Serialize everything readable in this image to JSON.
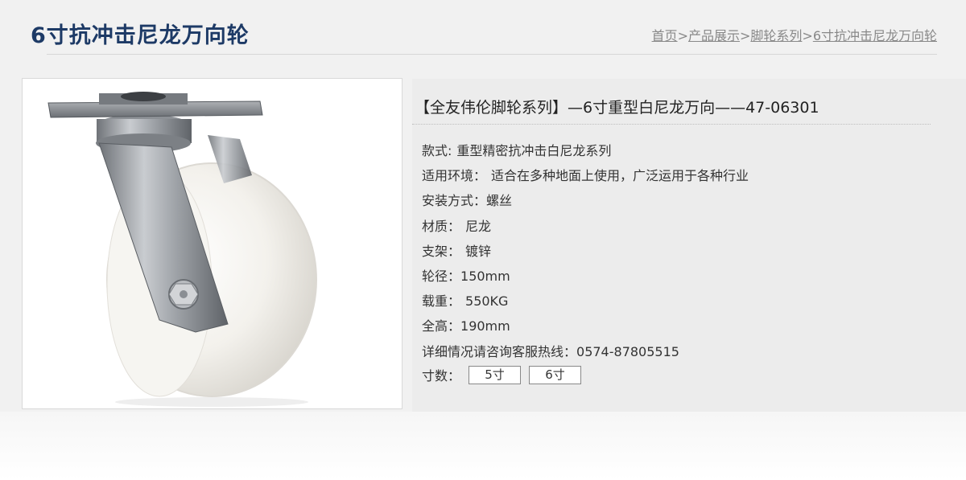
{
  "page_title": "6寸抗冲击尼龙万向轮",
  "breadcrumb": [
    {
      "label": "首页"
    },
    {
      "label": "产品展示"
    },
    {
      "label": "脚轮系列"
    },
    {
      "label": "6寸抗冲击尼龙万向轮"
    }
  ],
  "breadcrumb_separator": ">",
  "product": {
    "image_icon": "nylon-swivel-caster-wheel-photo",
    "heading": "【全友伟伦脚轮系列】—6寸重型白尼龙万向——47-06301",
    "specs": [
      {
        "label": "款式:",
        "value": "重型精密抗冲击白尼龙系列"
      },
      {
        "label": "适用环境：",
        "value": "适合在多种地面上使用，广泛运用于各种行业"
      },
      {
        "label": "安装方式：",
        "value": "螺丝"
      },
      {
        "label": "材质：",
        "value": "尼龙"
      },
      {
        "label": "支架：",
        "value": "镀锌"
      },
      {
        "label": "轮径：",
        "value": "150mm"
      },
      {
        "label": "载重：",
        "value": "550KG"
      },
      {
        "label": "全高：",
        "value": "190mm"
      },
      {
        "label": "详细情况请咨询客服热线：",
        "value": "0574-87805515"
      }
    ],
    "size_label": "寸数：",
    "sizes": [
      "5寸",
      "6寸"
    ]
  },
  "colors": {
    "title": "#1d3a66",
    "panel": "#ececec",
    "background": "#f1f1f1"
  }
}
